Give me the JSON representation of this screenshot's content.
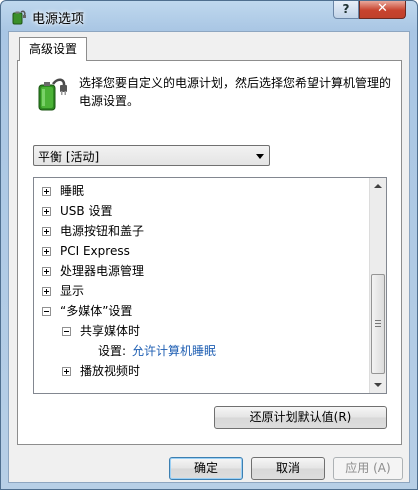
{
  "window": {
    "title": "电源选项",
    "help_label": "?",
    "close_label": "✕"
  },
  "tab": {
    "label": "高级设置"
  },
  "description": "选择您要自定义的电源计划，然后选择您希望计算机管理的电源设置。",
  "plan_select": {
    "value": "平衡 [活动]"
  },
  "tree": [
    {
      "label": "睡眠",
      "expander": "plus",
      "level": 0
    },
    {
      "label": "USB 设置",
      "expander": "plus",
      "level": 0
    },
    {
      "label": "电源按钮和盖子",
      "expander": "plus",
      "level": 0
    },
    {
      "label": "PCI Express",
      "expander": "plus",
      "level": 0
    },
    {
      "label": "处理器电源管理",
      "expander": "plus",
      "level": 0
    },
    {
      "label": "显示",
      "expander": "plus",
      "level": 0
    },
    {
      "label": "“多媒体”设置",
      "expander": "minus",
      "level": 0
    },
    {
      "label": "共享媒体时",
      "expander": "minus",
      "level": 1
    },
    {
      "label": "设置:",
      "value": "允许计算机睡眠",
      "level": 2
    },
    {
      "label": "播放视频时",
      "expander": "plus",
      "level": 1
    }
  ],
  "buttons": {
    "restore": "还原计划默认值(R)",
    "ok": "确定",
    "cancel": "取消",
    "apply": "应用 (A)"
  },
  "colors": {
    "link_value": "#1f5fb3",
    "close_red": "#c7432e"
  },
  "icons": {
    "app": "power-options-icon",
    "battery": "battery-plug-icon"
  }
}
